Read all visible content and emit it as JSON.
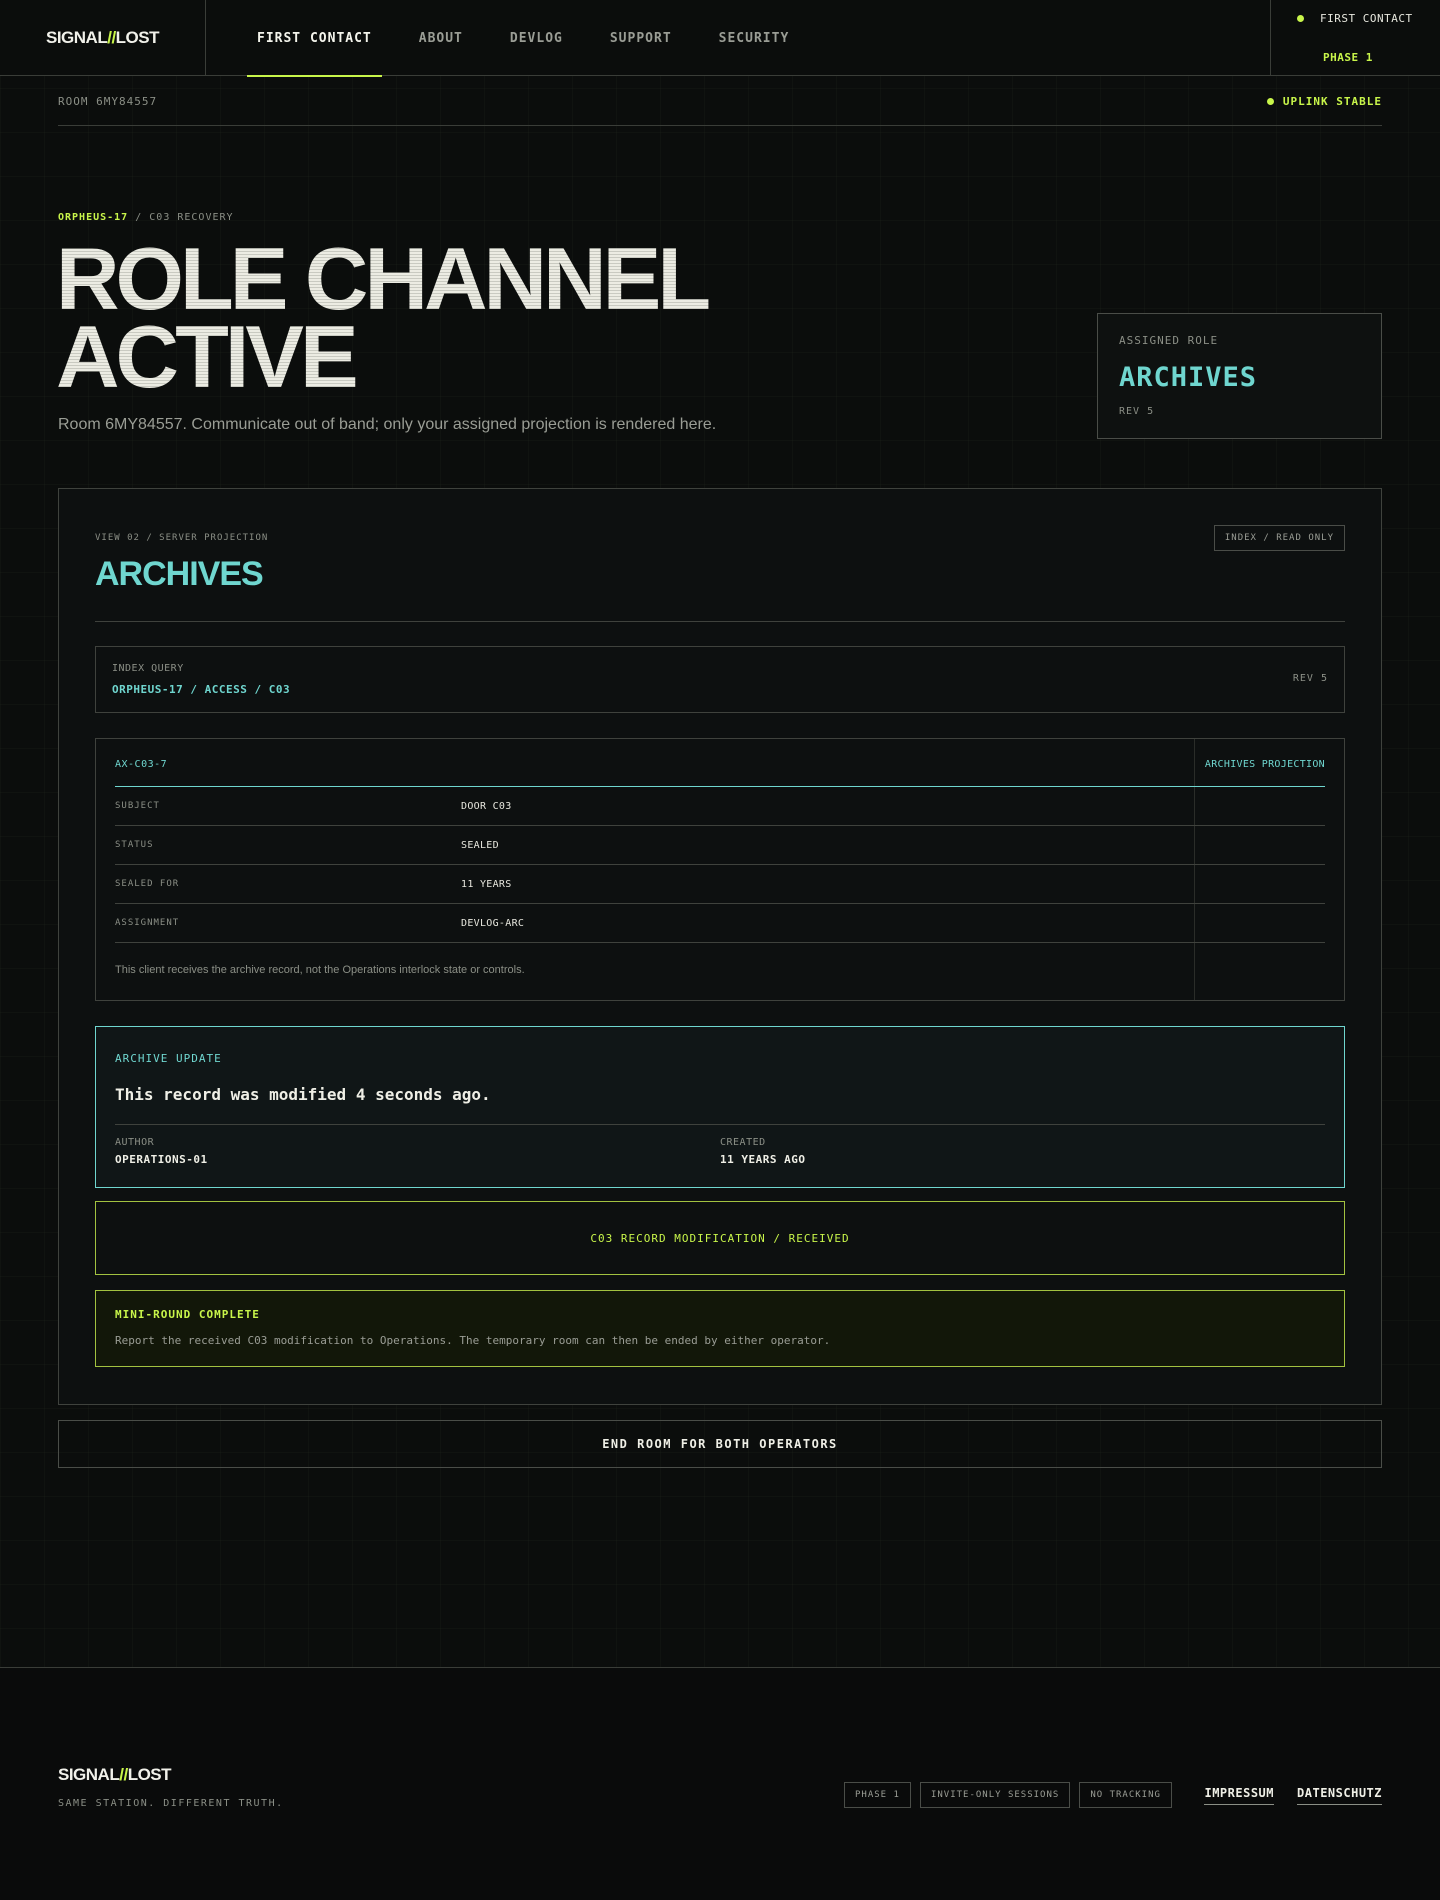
{
  "header": {
    "brand_left": "SIGNAL",
    "brand_sep": "//",
    "brand_right": "LOST",
    "nav": [
      {
        "label": "FIRST CONTACT",
        "active": true
      },
      {
        "label": "ABOUT"
      },
      {
        "label": "DEVLOG"
      },
      {
        "label": "SUPPORT"
      },
      {
        "label": "SECURITY"
      }
    ],
    "status_title": "FIRST CONTACT",
    "status_phase": "PHASE 1"
  },
  "statusbar": {
    "room": "ROOM 6MY84557",
    "uplink": "UPLINK STABLE"
  },
  "hero": {
    "kicker_accent": "ORPHEUS-17",
    "kicker_rest": " / C03 RECOVERY",
    "title_line1": "ROLE CHANNEL",
    "title_line2": "ACTIVE",
    "subtitle": "Room 6MY84557. Communicate out of band; only your assigned projection is rendered here."
  },
  "role_card": {
    "label": "ASSIGNED ROLE",
    "value": "ARCHIVES",
    "rev": "REV 5"
  },
  "panel": {
    "view_label": "VIEW 02 / SERVER PROJECTION",
    "title": "ARCHIVES",
    "badge": "INDEX / READ ONLY",
    "query": {
      "label": "INDEX QUERY",
      "value": "ORPHEUS-17 / ACCESS / C03",
      "rev": "REV 5"
    },
    "record": {
      "id": "AX-C03-7",
      "projection": "ARCHIVES PROJECTION",
      "rows": [
        {
          "key": "SUBJECT",
          "value": "DOOR C03"
        },
        {
          "key": "STATUS",
          "value": "SEALED"
        },
        {
          "key": "SEALED FOR",
          "value": "11 YEARS"
        },
        {
          "key": "ASSIGNMENT",
          "value": "DEVLOG-ARC"
        }
      ],
      "note": "This client receives the archive record, not the Operations interlock state or controls."
    },
    "update": {
      "label": "ARCHIVE UPDATE",
      "message": "This record was modified 4 seconds ago.",
      "author_label": "AUTHOR",
      "author_value": "OPERATIONS-01",
      "created_label": "CREATED",
      "created_value": "11 YEARS AGO"
    },
    "received": "C03 RECORD MODIFICATION / RECEIVED",
    "complete": {
      "title": "MINI-ROUND COMPLETE",
      "text": "Report the received C03 modification to Operations. The temporary room can then be ended by either operator."
    }
  },
  "end_button": "END ROOM FOR BOTH OPERATORS",
  "footer": {
    "brand_left": "SIGNAL",
    "brand_sep": "//",
    "brand_right": "LOST",
    "tagline": "SAME STATION. DIFFERENT TRUTH.",
    "badges": [
      "PHASE 1",
      "INVITE-ONLY SESSIONS",
      "NO TRACKING"
    ],
    "links": [
      "IMPRESSUM",
      "DATENSCHUTZ"
    ]
  },
  "colors": {
    "accent_lime": "#c8f54a",
    "accent_cyan": "#6fd6cf",
    "background": "#0b0d0c"
  }
}
